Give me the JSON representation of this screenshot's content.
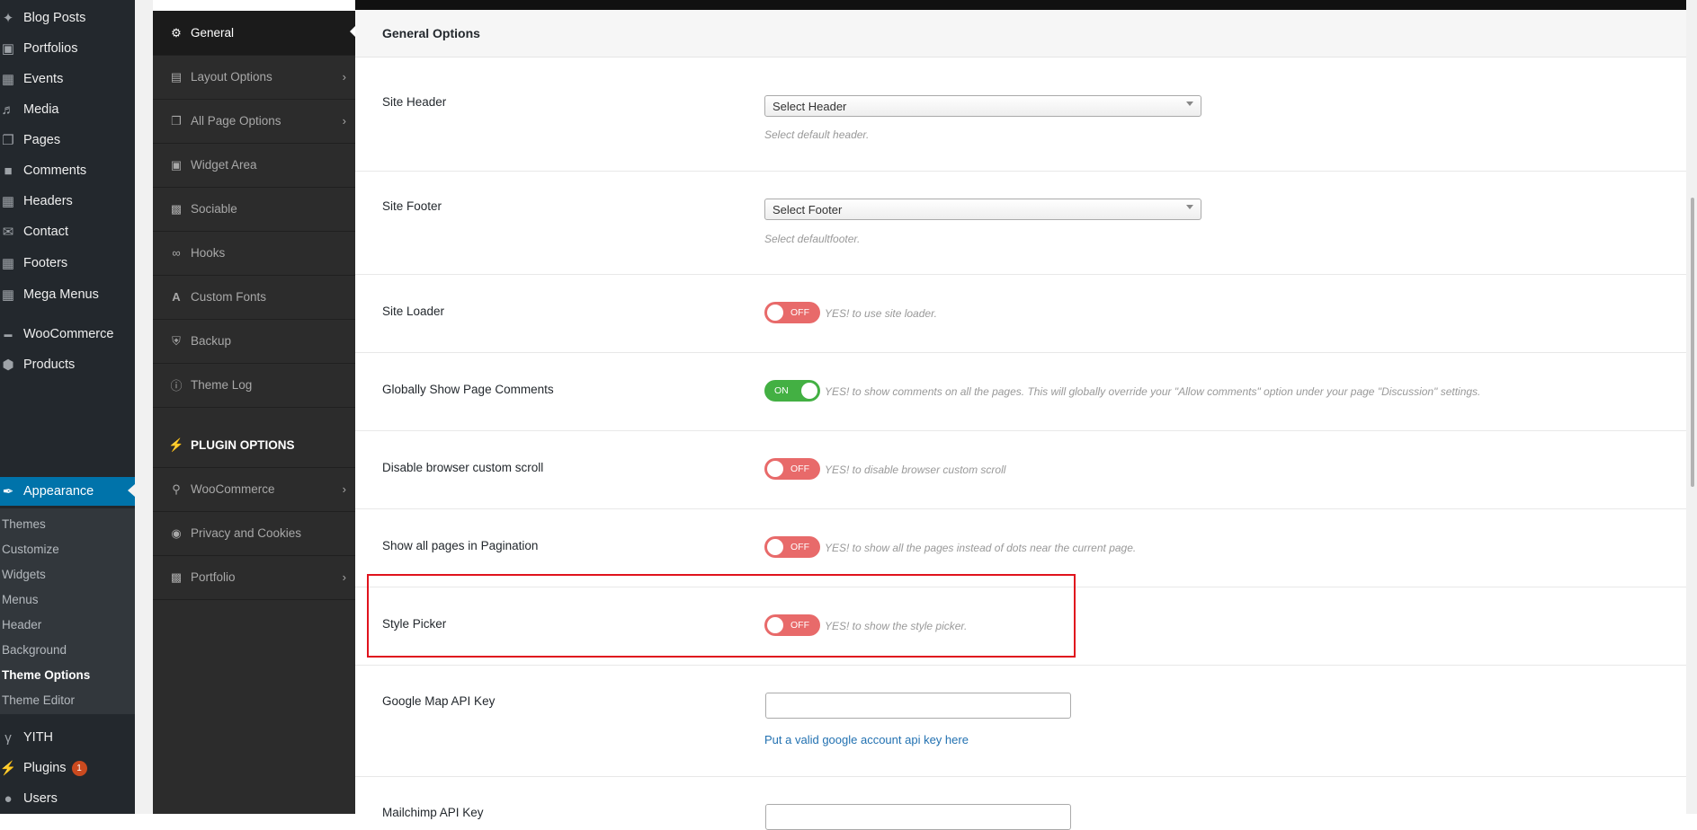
{
  "wp_menu": {
    "items": [
      {
        "label": "Blog Posts",
        "icon": "pin-icon"
      },
      {
        "label": "Portfolios",
        "icon": "portfolio-icon"
      },
      {
        "label": "Events",
        "icon": "calendar-icon"
      },
      {
        "label": "Media",
        "icon": "media-icon"
      },
      {
        "label": "Pages",
        "icon": "pages-icon"
      },
      {
        "label": "Comments",
        "icon": "comment-icon"
      },
      {
        "label": "Headers",
        "icon": "grid-icon"
      },
      {
        "label": "Contact",
        "icon": "mail-icon"
      },
      {
        "label": "Footers",
        "icon": "grid-icon"
      },
      {
        "label": "Mega Menus",
        "icon": "grid-icon"
      },
      {
        "label": "WooCommerce",
        "icon": "woo-icon"
      },
      {
        "label": "Products",
        "icon": "box-icon"
      }
    ],
    "appearance": "Appearance",
    "sub_items": [
      "Themes",
      "Customize",
      "Widgets",
      "Menus",
      "Header",
      "Background",
      "Theme Options",
      "Theme Editor"
    ],
    "yith": "YITH",
    "plugins": "Plugins",
    "plugins_badge": "1",
    "users": "Users"
  },
  "options_menu": {
    "items": [
      "General",
      "Layout Options",
      "All Page Options",
      "Widget Area",
      "Sociable",
      "Hooks",
      "Custom Fonts",
      "Backup",
      "Theme Log"
    ],
    "plugin_heading": "PLUGIN OPTIONS",
    "plugin_items": [
      "WooCommerce",
      "Privacy and Cookies",
      "Portfolio"
    ]
  },
  "main": {
    "title": "General Options",
    "site_header": {
      "label": "Site Header",
      "value": "Select Header",
      "desc": "Select default header."
    },
    "site_footer": {
      "label": "Site Footer",
      "value": "Select Footer",
      "desc": "Select defaultfooter."
    },
    "site_loader": {
      "label": "Site Loader",
      "state": "OFF",
      "desc": "YES! to use site loader."
    },
    "page_comments": {
      "label": "Globally Show Page Comments",
      "state": "ON",
      "desc": "YES! to show comments on all the pages. This will globally override your \"Allow comments\" option under your page \"Discussion\" settings."
    },
    "custom_scroll": {
      "label": "Disable browser custom scroll",
      "state": "OFF",
      "desc": "YES! to disable browser custom scroll"
    },
    "pagination": {
      "label": "Show all pages in Pagination",
      "state": "OFF",
      "desc": "YES! to show all the pages instead of dots near the current page."
    },
    "style_picker": {
      "label": "Style Picker",
      "state": "OFF",
      "desc": "YES! to show the style picker."
    },
    "google_map": {
      "label": "Google Map API Key",
      "value": "",
      "link": "Put a valid google account api key here"
    },
    "mailchimp": {
      "label": "Mailchimp API Key",
      "value": ""
    }
  },
  "colors": {
    "accent": "#0073aa",
    "toggle_off": "#e86a6a",
    "toggle_on": "#43b043",
    "highlight": "#e0131d"
  }
}
